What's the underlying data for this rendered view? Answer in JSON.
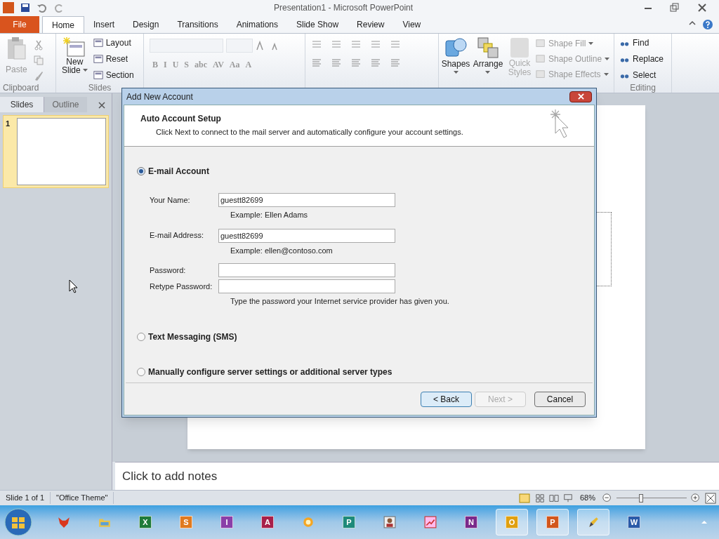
{
  "window": {
    "title": "Presentation1  -  Microsoft PowerPoint"
  },
  "ribbon_tabs": [
    {
      "label": "File",
      "kind": "file",
      "selected": false
    },
    {
      "label": "Home",
      "kind": "tab",
      "selected": true
    },
    {
      "label": "Insert",
      "kind": "tab",
      "selected": false
    },
    {
      "label": "Design",
      "kind": "tab",
      "selected": false
    },
    {
      "label": "Transitions",
      "kind": "tab",
      "selected": false
    },
    {
      "label": "Animations",
      "kind": "tab",
      "selected": false
    },
    {
      "label": "Slide Show",
      "kind": "tab",
      "selected": false
    },
    {
      "label": "Review",
      "kind": "tab",
      "selected": false
    },
    {
      "label": "View",
      "kind": "tab",
      "selected": false
    }
  ],
  "clipboard": {
    "paste": "Paste",
    "label": "Clipboard"
  },
  "slides_group": {
    "new_slide": [
      "New",
      "Slide"
    ],
    "commands": [
      "Layout",
      "Reset",
      "Section"
    ],
    "label": "Slides"
  },
  "font_buttons": [
    "B",
    "I",
    "U",
    "S",
    "abc",
    "AV",
    "Aa",
    "A"
  ],
  "drawing": {
    "shapes": "Shapes",
    "arrange": "Arrange",
    "quick_styles": [
      "Quick",
      "Styles"
    ],
    "commands": [
      {
        "label": "Shape Fill",
        "disabled": true
      },
      {
        "label": "Shape Outline",
        "disabled": true
      },
      {
        "label": "Shape Effects",
        "disabled": true
      }
    ]
  },
  "editing": {
    "commands": [
      "Find",
      "Replace",
      "Select"
    ],
    "label": "Editing"
  },
  "pane_tabs": [
    {
      "label": "Slides",
      "selected": true
    },
    {
      "label": "Outline",
      "selected": false
    }
  ],
  "thumbnails": [
    {
      "number": "1",
      "selected": true
    }
  ],
  "notes": {
    "placeholder": "Click to add notes"
  },
  "dialog": {
    "title": "Add New Account",
    "heading": "Auto Account Setup",
    "subheading": "Click Next to connect to the mail server and automatically configure your account settings.",
    "options": [
      {
        "label": "E-mail Account",
        "selected": true
      },
      {
        "label": "Text Messaging (SMS)",
        "selected": false
      },
      {
        "label": "Manually configure server settings or additional server types",
        "selected": false
      }
    ],
    "fields": [
      {
        "label": "Your Name:",
        "value": "guestt82699",
        "hint": "Example: Ellen Adams"
      },
      {
        "label": "E-mail Address:",
        "value": "guestt82699",
        "hint": "Example: ellen@contoso.com"
      },
      {
        "label": "Password:"
      },
      {
        "label": "Retype Password:",
        "hint": "Type the password your Internet service provider has given you."
      }
    ],
    "buttons": [
      {
        "label": "< Back",
        "kind": "default",
        "disabled": false
      },
      {
        "label": "Next >",
        "kind": "normal",
        "disabled": true
      },
      {
        "label": "Cancel",
        "kind": "normal",
        "disabled": false
      }
    ]
  },
  "status_bar": {
    "slide": "Slide 1 of 1",
    "theme": "\"Office Theme\"",
    "zoom": "68%",
    "zoom_slider": {
      "level": 0.35
    }
  },
  "taskbar": [
    {
      "kind": "fox",
      "selected": false
    },
    {
      "kind": "folder",
      "selected": false
    },
    {
      "kind": "letter",
      "letter": "X",
      "color": "#1f7a3a",
      "selected": false
    },
    {
      "kind": "letter",
      "letter": "S",
      "color": "#e07a1f",
      "selected": false
    },
    {
      "kind": "letter",
      "letter": "I",
      "color": "#8a3fa8",
      "selected": false
    },
    {
      "kind": "letter",
      "letter": "A",
      "color": "#a8204a",
      "selected": false
    },
    {
      "kind": "sun",
      "selected": false
    },
    {
      "kind": "letter",
      "letter": "P",
      "color": "#1e8a7a",
      "selected": false
    },
    {
      "kind": "person",
      "selected": false
    },
    {
      "kind": "chart",
      "selected": false
    },
    {
      "kind": "letter",
      "letter": "N",
      "color": "#7a2a8a",
      "selected": false
    },
    {
      "kind": "letter",
      "letter": "O",
      "color": "#e0a010",
      "selected": true
    },
    {
      "kind": "letter",
      "letter": "P",
      "color": "#d2561c",
      "selected": true
    },
    {
      "kind": "pencil",
      "selected": true
    },
    {
      "kind": "letter",
      "letter": "W",
      "color": "#2a5aa8",
      "selected": false
    }
  ]
}
